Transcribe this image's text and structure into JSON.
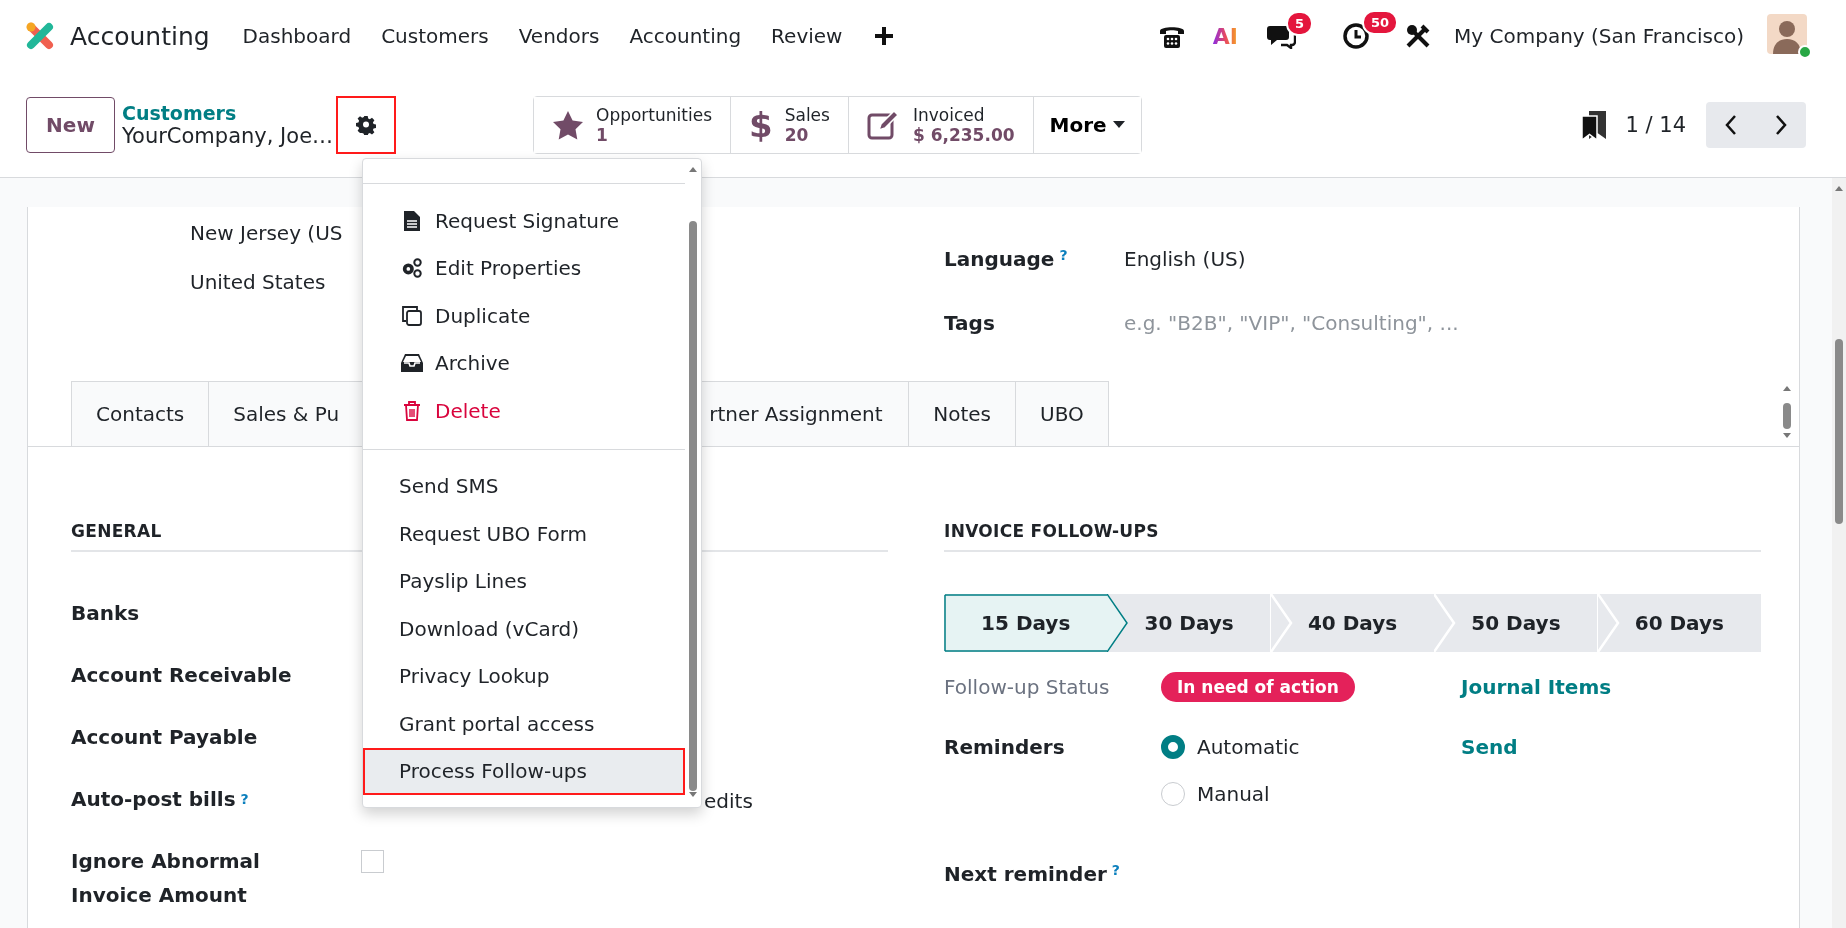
{
  "navbar": {
    "app_name": "Accounting",
    "menu": [
      "Dashboard",
      "Customers",
      "Vendors",
      "Accounting",
      "Review"
    ],
    "ai_label": "AI",
    "messages_count": "5",
    "activities_count": "50",
    "company": "My Company (San Francisco)"
  },
  "control_panel": {
    "new_button": "New",
    "breadcrumb": "Customers",
    "record_name": "YourCompany, Joe…",
    "gear_highlighted": true,
    "stat_buttons": [
      {
        "kind": "star",
        "label": "Opportunities",
        "value": "1"
      },
      {
        "kind": "glyph",
        "glyph": "$",
        "label": "Sales",
        "value": "20"
      },
      {
        "kind": "edit",
        "label": "Invoiced",
        "value": "$ 6,235.00"
      }
    ],
    "more_button": "More",
    "pager": "1 / 14"
  },
  "form": {
    "address_lines": [
      "New Jersey (US",
      "United States"
    ],
    "right_fields": [
      {
        "kind": "value",
        "label": "Language",
        "help": "?",
        "value": "English (US)"
      },
      {
        "kind": "placeholder",
        "label": "Tags",
        "placeholder": "e.g. \"B2B\", \"VIP\", \"Consulting\", ..."
      }
    ],
    "tabs": [
      {
        "label": "Contacts",
        "selected": false
      },
      {
        "label": "Sales & Pu",
        "selected": false
      },
      {
        "label": "rtner Assignment",
        "selected": false
      },
      {
        "label": "Notes",
        "selected": false
      },
      {
        "label": "UBO",
        "selected": false
      }
    ],
    "general": {
      "heading": "GENERAL",
      "fields": [
        {
          "kind": "text",
          "label": "Banks"
        },
        {
          "kind": "text",
          "label": "Account Receivable"
        },
        {
          "kind": "text",
          "label": "Account Payable"
        },
        {
          "kind": "text",
          "label": "Auto-post bills",
          "help": "?",
          "value": "edits"
        },
        {
          "kind": "checkbox",
          "label": "Ignore Abnormal Invoice Amount",
          "checked": false
        }
      ]
    },
    "followups": {
      "heading": "INVOICE FOLLOW-UPS",
      "steps": [
        {
          "label": "15 Days",
          "selected": true
        },
        {
          "label": "30 Days",
          "selected": false
        },
        {
          "label": "40 Days",
          "selected": false
        },
        {
          "label": "50 Days",
          "selected": false
        },
        {
          "label": "60 Days",
          "selected": false
        }
      ],
      "status_label": "Follow-up Status",
      "status": "In need of action",
      "journal_link": "Journal Items",
      "reminders_label": "Reminders",
      "reminder_options": [
        {
          "label": "Automatic",
          "selected": true
        },
        {
          "label": "Manual",
          "selected": false
        }
      ],
      "send_link": "Send",
      "next_reminder_label": "Next reminder",
      "next_reminder_help": "?"
    }
  },
  "dropdown": {
    "sections": [
      [
        {
          "kind": "icon",
          "label": "Request Signature",
          "danger": false,
          "highlighted": false
        },
        {
          "kind": "icon",
          "label": "Edit Properties",
          "danger": false,
          "highlighted": false
        },
        {
          "kind": "icon",
          "label": "Duplicate",
          "danger": false,
          "highlighted": false
        },
        {
          "kind": "icon",
          "label": "Archive",
          "danger": false,
          "highlighted": false
        },
        {
          "kind": "icon",
          "label": "Delete",
          "danger": true,
          "highlighted": false
        }
      ],
      [
        {
          "kind": "text",
          "label": "Send SMS",
          "danger": false,
          "highlighted": false
        },
        {
          "kind": "text",
          "label": "Request UBO Form",
          "danger": false,
          "highlighted": false
        },
        {
          "kind": "text",
          "label": "Payslip Lines",
          "danger": false,
          "highlighted": false
        },
        {
          "kind": "text",
          "label": "Download (vCard)",
          "danger": false,
          "highlighted": false
        },
        {
          "kind": "text",
          "label": "Privacy Lookup",
          "danger": false,
          "highlighted": false
        },
        {
          "kind": "text",
          "label": "Grant portal access",
          "danger": false,
          "highlighted": false
        },
        {
          "kind": "text",
          "label": "Process Follow-ups",
          "danger": false,
          "highlighted": true
        }
      ]
    ]
  }
}
